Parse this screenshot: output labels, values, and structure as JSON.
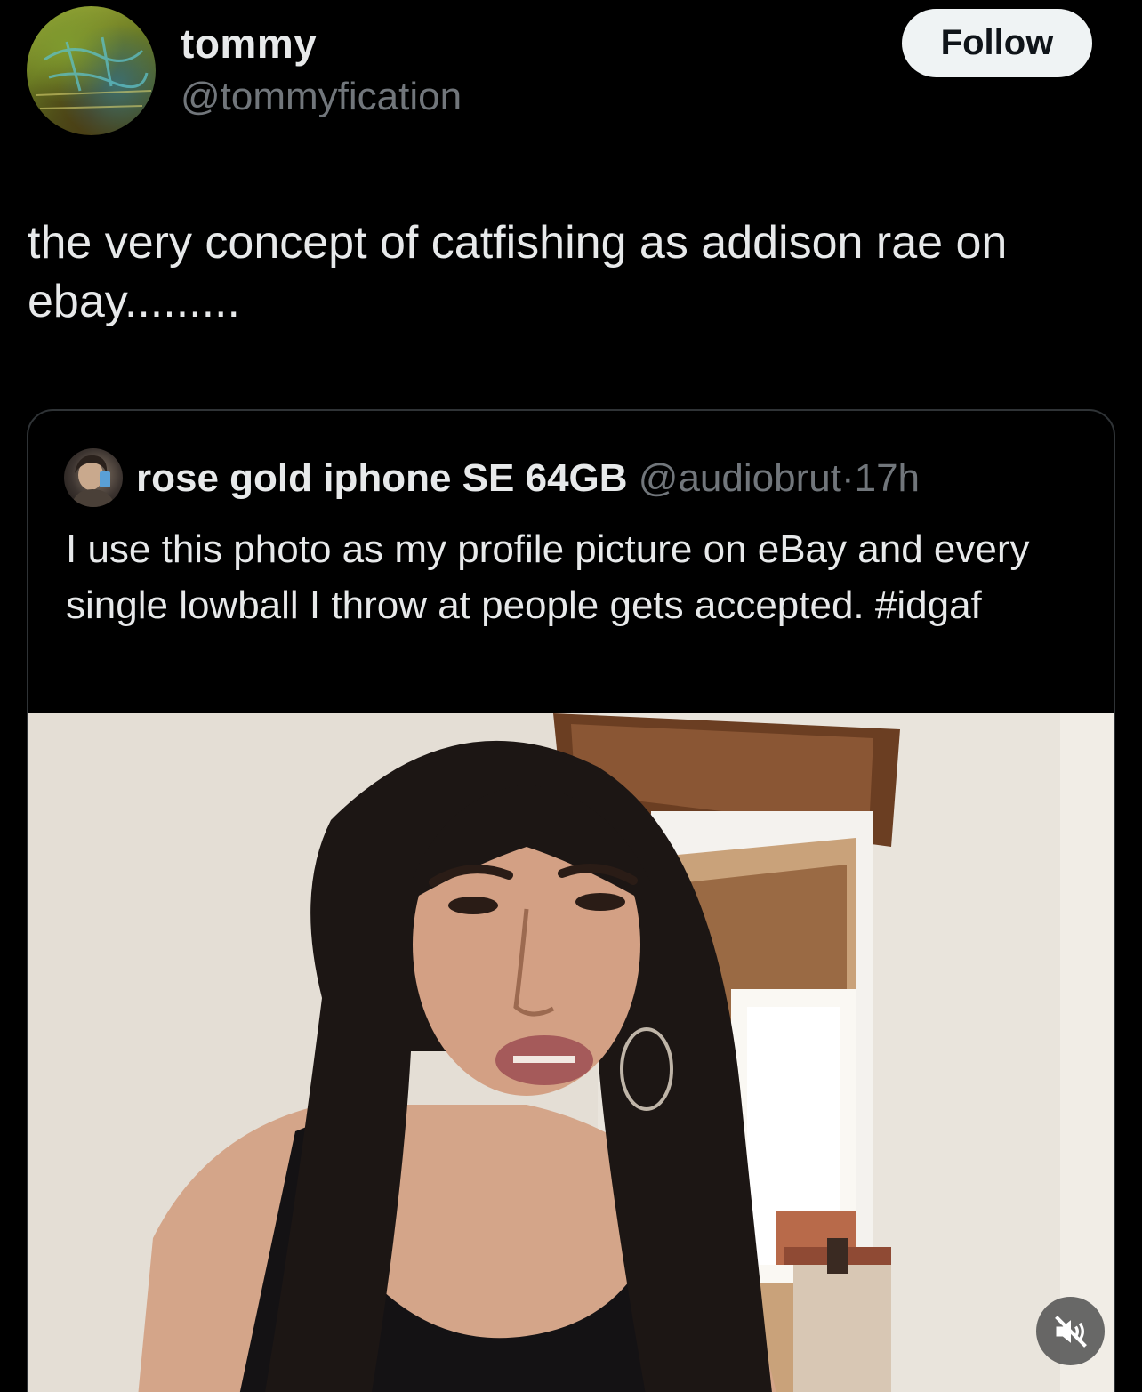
{
  "author": {
    "name": "tommy",
    "handle": "@tommyfication",
    "follow_label": "Follow"
  },
  "post": {
    "text": "the very concept of catfishing as addison rae on ebay........."
  },
  "quoted": {
    "name": "rose gold iphone SE 64GB",
    "handle": "@audiobrut",
    "separator": "·",
    "time": "17h",
    "text": "I use this photo as my profile picture on eBay and every single lowball I throw at people gets accepted. #idgaf"
  },
  "media": {
    "icon": "speaker-muted-icon"
  }
}
